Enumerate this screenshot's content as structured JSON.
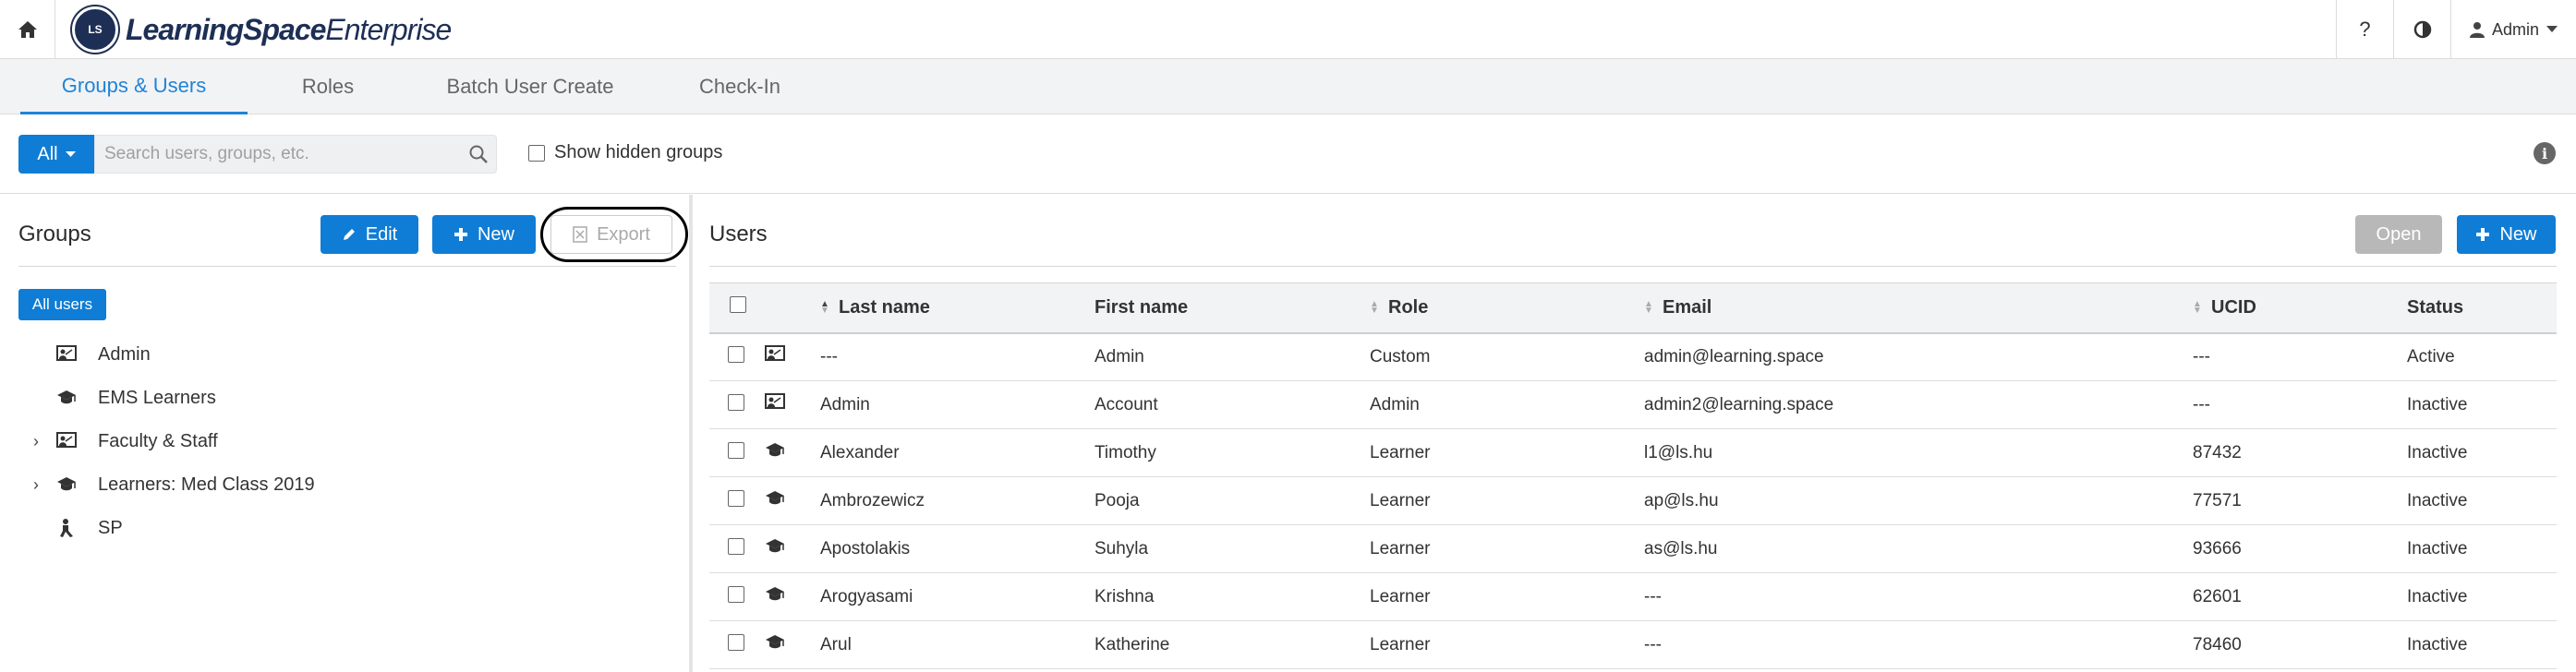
{
  "header": {
    "logo_badge": "LS",
    "logo_bold": "LearningSpace",
    "logo_light": "Enterprise",
    "help_label": "?",
    "user_label": "Admin"
  },
  "tabs": [
    {
      "label": "Groups & Users",
      "active": true
    },
    {
      "label": "Roles",
      "active": false
    },
    {
      "label": "Batch User Create",
      "active": false
    },
    {
      "label": "Check-In",
      "active": false
    }
  ],
  "filter": {
    "scope_label": "All",
    "search_placeholder": "Search users, groups, etc.",
    "search_value": "",
    "show_hidden_label": "Show hidden groups",
    "show_hidden_checked": false
  },
  "groups_panel": {
    "title": "Groups",
    "edit_label": "Edit",
    "new_label": "New",
    "export_label": "Export",
    "all_users_label": "All users",
    "items": [
      {
        "label": "Admin",
        "icon": "instructor-icon",
        "expandable": false
      },
      {
        "label": "EMS Learners",
        "icon": "graduation-cap-icon",
        "expandable": false
      },
      {
        "label": "Faculty & Staff",
        "icon": "instructor-icon",
        "expandable": true
      },
      {
        "label": "Learners: Med Class 2019",
        "icon": "graduation-cap-icon",
        "expandable": true
      },
      {
        "label": "SP",
        "icon": "standardized-patient-icon",
        "expandable": false
      }
    ]
  },
  "users_panel": {
    "title": "Users",
    "open_label": "Open",
    "new_label": "New",
    "columns": [
      "Last name",
      "First name",
      "Role",
      "Email",
      "UCID",
      "Status"
    ],
    "rows": [
      {
        "icon": "instructor-icon",
        "last": "---",
        "first": "Admin",
        "role": "Custom",
        "email": "admin@learning.space",
        "ucid": "---",
        "status": "Active"
      },
      {
        "icon": "instructor-icon",
        "last": "Admin",
        "first": "Account",
        "role": "Admin",
        "email": "admin2@learning.space",
        "ucid": "---",
        "status": "Inactive"
      },
      {
        "icon": "graduation-cap-icon",
        "last": "Alexander",
        "first": "Timothy",
        "role": "Learner",
        "email": "l1@ls.hu",
        "ucid": "87432",
        "status": "Inactive"
      },
      {
        "icon": "graduation-cap-icon",
        "last": "Ambrozewicz",
        "first": "Pooja",
        "role": "Learner",
        "email": "ap@ls.hu",
        "ucid": "77571",
        "status": "Inactive"
      },
      {
        "icon": "graduation-cap-icon",
        "last": "Apostolakis",
        "first": "Suhyla",
        "role": "Learner",
        "email": "as@ls.hu",
        "ucid": "93666",
        "status": "Inactive"
      },
      {
        "icon": "graduation-cap-icon",
        "last": "Arogyasami",
        "first": "Krishna",
        "role": "Learner",
        "email": "---",
        "ucid": "62601",
        "status": "Inactive"
      },
      {
        "icon": "graduation-cap-icon",
        "last": "Arul",
        "first": "Katherine",
        "role": "Learner",
        "email": "---",
        "ucid": "78460",
        "status": "Inactive"
      }
    ]
  },
  "colors": {
    "accent": "#0f7dd6",
    "tab_active": "#1f84d6",
    "brand": "#1e2f55"
  }
}
